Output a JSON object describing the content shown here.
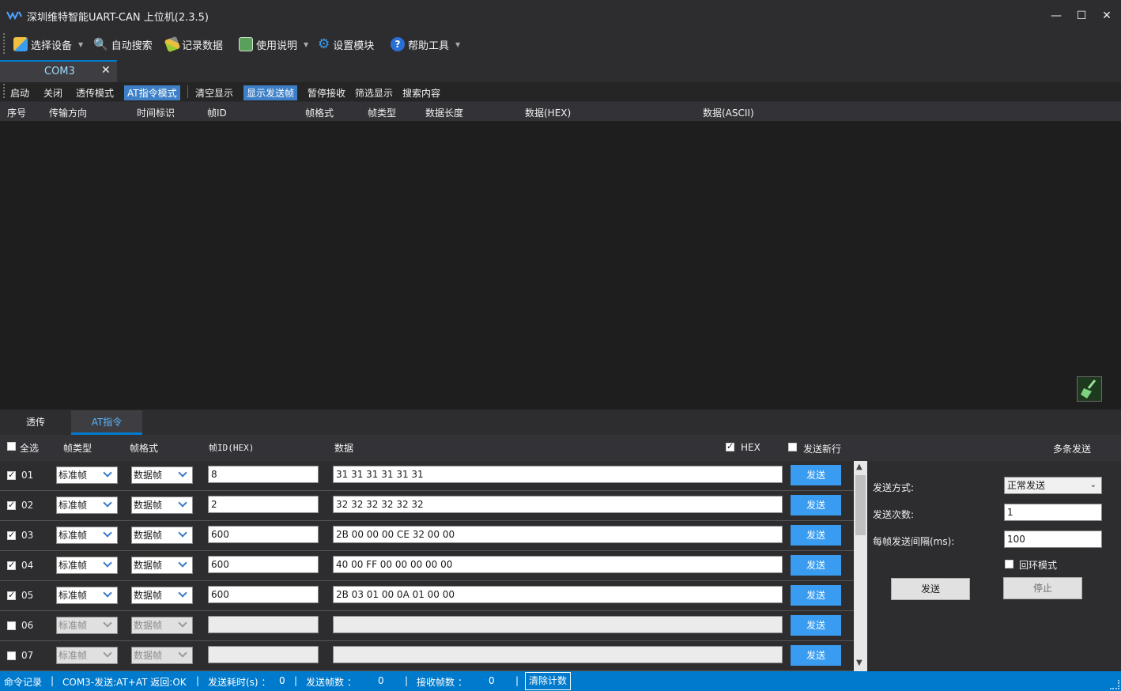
{
  "window": {
    "title": "深圳维特智能UART-CAN 上位机(2.3.5)",
    "minimize": "—",
    "maximize": "☐",
    "close": "✕"
  },
  "toolbar": {
    "select_device": "选择设备",
    "auto_search": "自动搜索",
    "record_data": "记录数据",
    "manual": "使用说明",
    "settings": "设置模块",
    "help_tools": "帮助工具"
  },
  "doc_tab": {
    "label": "COM3",
    "close": "✕"
  },
  "actions": {
    "start": "启动",
    "close": "关闭",
    "passthrough_mode": "透传模式",
    "at_mode": "AT指令模式",
    "clear_display": "清空显示",
    "show_sent_frames": "显示发送帧",
    "pause_receive": "暂停接收",
    "filter_display": "筛选显示",
    "search_content": "搜索内容"
  },
  "grid_columns": [
    "序号",
    "传输方向",
    "时间标识",
    "帧ID",
    "帧格式",
    "帧类型",
    "数据长度",
    "数据(HEX)",
    "数据(ASCII)"
  ],
  "bottom_tabs": {
    "passthrough": "透传",
    "at": "AT指令"
  },
  "send_header": {
    "select_all": "全选",
    "frame_type": "帧类型",
    "frame_format": "帧格式",
    "frame_id": "帧ID(HEX)",
    "data": "数据",
    "hex": "HEX",
    "newline": "发送新行",
    "multi_send": "多条发送"
  },
  "send_rows": [
    {
      "num": "01",
      "checked": true,
      "type": "标准帧",
      "format": "数据帧",
      "id": "8",
      "data": "31 31 31 31 31 31",
      "send": "发送",
      "enabled": true
    },
    {
      "num": "02",
      "checked": true,
      "type": "标准帧",
      "format": "数据帧",
      "id": "2",
      "data": "32 32 32 32 32 32",
      "send": "发送",
      "enabled": true
    },
    {
      "num": "03",
      "checked": true,
      "type": "标准帧",
      "format": "数据帧",
      "id": "600",
      "data": "2B 00 00 00 CE 32 00 00",
      "send": "发送",
      "enabled": true
    },
    {
      "num": "04",
      "checked": true,
      "type": "标准帧",
      "format": "数据帧",
      "id": "600",
      "data": "40 00 FF 00 00 00 00 00",
      "send": "发送",
      "enabled": true
    },
    {
      "num": "05",
      "checked": true,
      "type": "标准帧",
      "format": "数据帧",
      "id": "600",
      "data": "2B 03 01 00 0A 01 00 00",
      "send": "发送",
      "enabled": true
    },
    {
      "num": "06",
      "checked": false,
      "type": "标准帧",
      "format": "数据帧",
      "id": "",
      "data": "",
      "send": "发送",
      "enabled": false
    },
    {
      "num": "07",
      "checked": false,
      "type": "标准帧",
      "format": "数据帧",
      "id": "",
      "data": "",
      "send": "发送",
      "enabled": false
    }
  ],
  "send_panel": {
    "mode_label": "发送方式:",
    "mode_value": "正常发送",
    "count_label": "发送次数:",
    "count_value": "1",
    "interval_label": "每帧发送间隔(ms):",
    "interval_value": "100",
    "loop_mode": "回环模式",
    "send": "发送",
    "stop": "停止"
  },
  "status": {
    "cmd_log": "命令记录",
    "last": "COM3-发送:AT+AT 返回:OK",
    "time_label": "发送耗时(s) ：",
    "time_value": "0",
    "sent_label": "发送帧数 ：",
    "sent_value": "0",
    "recv_label": "接收帧数 ：",
    "recv_value": "0",
    "clear": "清除计数"
  },
  "colors": {
    "accent": "#007acc",
    "send_button": "#3a9cf0",
    "dark_bg": "#2d2d30"
  }
}
